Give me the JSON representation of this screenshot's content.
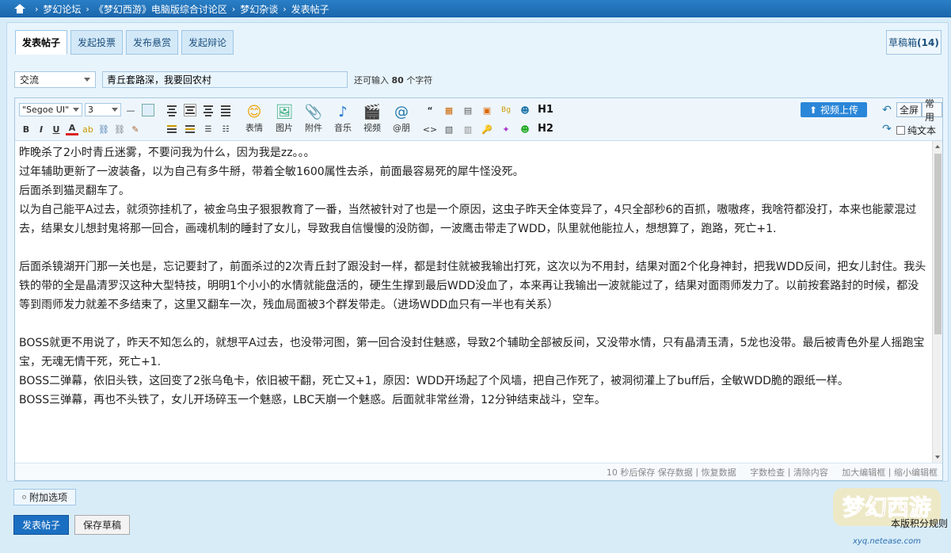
{
  "breadcrumb": [
    "梦幻论坛",
    "《梦幻西游》电脑版综合讨论区",
    "梦幻杂谈",
    "发表帖子"
  ],
  "tabs": [
    "发表帖子",
    "发起投票",
    "发布悬赏",
    "发起辩论"
  ],
  "draft": {
    "label": "草稿箱",
    "count": "(14)"
  },
  "category": "交流",
  "title": "青丘套路深，我要回农村",
  "remain": {
    "prefix": "还可输入",
    "count": "80",
    "suffix": "个字符"
  },
  "toolbar": {
    "font": "\"Segoe UI\"",
    "size": "3",
    "emoji": "表情",
    "image": "图片",
    "attach": "附件",
    "music": "音乐",
    "video": "视频",
    "at": "@朋",
    "h1": "H1",
    "h2": "H2",
    "upload": "视频上传",
    "fullscreen": "全屏",
    "common": "常用",
    "plaintext": "纯文本"
  },
  "content": [
    "昨晚杀了2小时青丘迷雾，不要问我为什么，因为我是zz。。。",
    "过年辅助更新了一波装备，以为自己有多牛掰，带着全敏1600属性去杀，前面最容易死的犀牛怪没死。",
    "后面杀到猫灵翻车了。",
    "以为自己能平A过去，就须弥挂机了，被金乌虫子狠狠教育了一番，当然被针对了也是一个原因，这虫子昨天全体变异了，4只全部秒6的百抓，嗷嗷疼，我啥符都没打，本来也能蒙混过去，结果女儿想封鬼将那一回合，画魂机制的睡封了女儿，导致我自信慢慢的没防御，一波鹰击带走了WDD，队里就他能拉人，想想算了，跑路，死亡+1.",
    "",
    "后面杀镜湖开门那一关也是，忘记要封了，前面杀过的2次青丘封了跟没封一样，都是封住就被我输出打死，这次以为不用封，结果对面2个化身神封，把我WDD反间，把女儿封住。我头铁的带的全是晶清罗汉这种大型特技，明明1个小小的水情就能盘活的，硬生生撑到最后WDD没血了，本来再让我输出一波就能过了，结果对面雨师发力了。以前按套路封的时候，都没等到雨师发力就差不多结束了，这里又翻车一次，残血局面被3个群发带走。（进场WDD血只有一半也有关系）",
    "",
    "BOSS就更不用说了，昨天不知怎么的，就想平A过去，也没带河图，第一回合没封住魅惑，导致2个辅助全部被反间，又没带水情，只有晶清玉清，5龙也没带。最后被青色外星人摇跑宝宝，无魂无情干死，死亡+1.",
    "BOSS二弹幕，依旧头铁，这回变了2张乌龟卡，依旧被干翻，死亡又+1，原因：WDD开场起了个风墙，把自己作死了，被洞彻灌上了buff后，全敏WDD脆的跟纸一样。",
    "BOSS三弹幕，再也不头铁了，女儿开场碎玉一个魅惑，LBC天崩一个魅惑。后面就非常丝滑，12分钟结束战斗，空车。"
  ],
  "status": {
    "autosave": "10 秒后保存",
    "save_data": "保存数据",
    "restore": "恢复数据",
    "check": "字数检查",
    "clear": "清除内容",
    "enlarge": "加大编辑框",
    "shrink": "缩小编辑框"
  },
  "extra_options": "附加选项",
  "buttons": {
    "post": "发表帖子",
    "save_draft": "保存草稿"
  },
  "rule_link": "本版积分规则",
  "logo": {
    "text": "梦幻西游",
    "url": "xyq.netease.com"
  },
  "colors": {
    "accent": "#1b6fc2",
    "topbar": "#1f71b8",
    "panel": "#e8f4fc"
  }
}
